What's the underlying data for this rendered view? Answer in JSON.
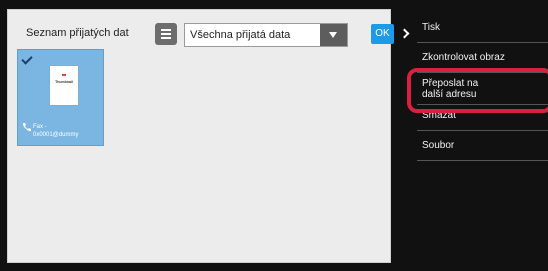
{
  "main": {
    "title": "Seznam přijatých dat",
    "filter": {
      "selected": "Všechna přijatá data"
    },
    "ok_label": "OK",
    "thumbnail": {
      "label_line1": "Fax -",
      "label_line2": "0x0001@dummy",
      "doc_text": "Thumbnail"
    }
  },
  "side_menu": {
    "items": [
      {
        "label": "Tisk"
      },
      {
        "label": "Zkontrolovat obraz"
      },
      {
        "label_line1": "Přeposlat na",
        "label_line2": "další adresu"
      },
      {
        "label": "Smazat"
      },
      {
        "label": "Soubor"
      }
    ]
  },
  "colors": {
    "accent": "#1e9be8",
    "selection": "#7bb6e3",
    "highlight": "#d7223f",
    "panel": "#111111"
  }
}
